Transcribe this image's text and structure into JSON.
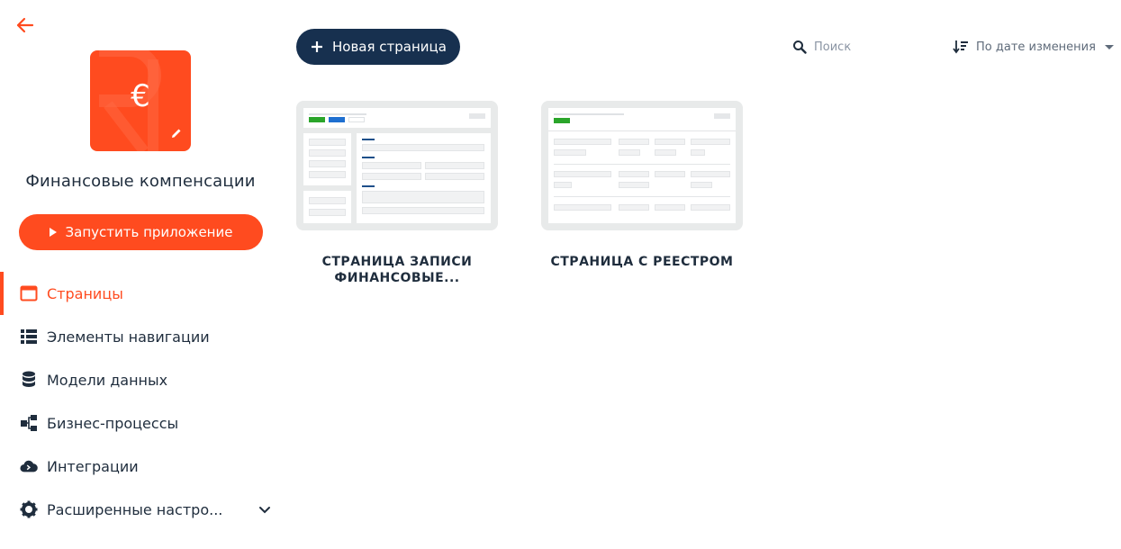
{
  "sidebar": {
    "app_title": "Финансовые компенсации",
    "run_button": "Запустить приложение",
    "items": [
      {
        "label": "Страницы",
        "icon": "window-icon",
        "active": true
      },
      {
        "label": "Элементы навигации",
        "icon": "list-icon"
      },
      {
        "label": "Модели данных",
        "icon": "database-icon"
      },
      {
        "label": "Бизнес-процессы",
        "icon": "process-icon"
      },
      {
        "label": "Интеграции",
        "icon": "cloud-icon"
      },
      {
        "label": "Расширенные настро...",
        "icon": "gear-icon"
      }
    ]
  },
  "toolbar": {
    "new_page": "Новая страница",
    "search_placeholder": "Поиск",
    "sort_label": "По дате изменения"
  },
  "pages": [
    {
      "title": "СТРАНИЦА ЗАПИСИ\nФИНАНСОВЫЕ..."
    },
    {
      "title": "СТРАНИЦА С РЕЕСТРОМ"
    }
  ],
  "colors": {
    "accent": "#ff4b1f",
    "navy": "#17304f",
    "text": "#1f2d3d"
  }
}
